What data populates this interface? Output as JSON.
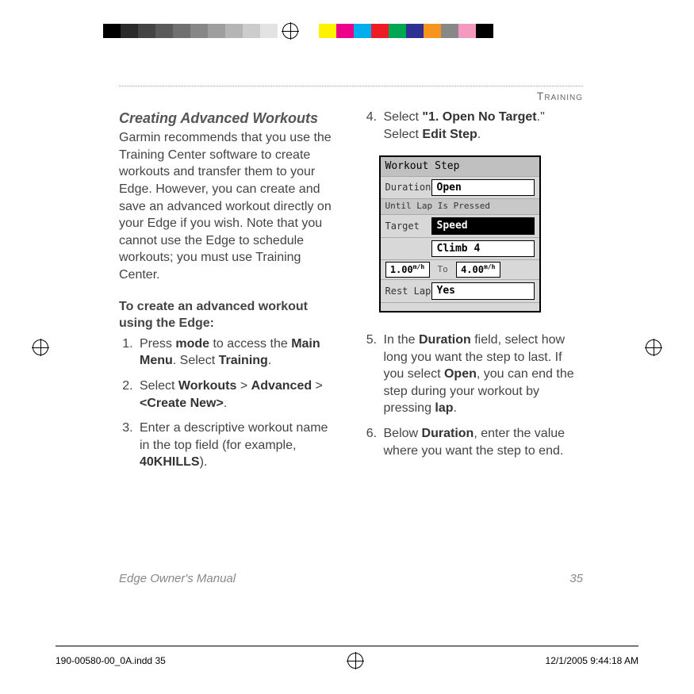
{
  "header": {
    "section": "Training"
  },
  "leftCol": {
    "title": "Creating Advanced Workouts",
    "intro": "Garmin recommends that you use the Training Center software to create workouts and transfer them to your Edge. However, you can create and save an advanced workout directly on your Edge if you wish. Note that you cannot use the Edge to schedule workouts; you must use Training Center.",
    "leadIn": "To create an advanced workout using the Edge:",
    "steps": {
      "s1_a": "Press ",
      "s1_b": "mode",
      "s1_c": " to access the ",
      "s1_d": "Main Menu",
      "s1_e": ". Select ",
      "s1_f": "Training",
      "s1_g": ".",
      "s2_a": "Select ",
      "s2_b": "Workouts",
      "s2_c": " > ",
      "s2_d": "Advanced",
      "s2_e": " > ",
      "s2_f": "<Create New>",
      "s2_g": ".",
      "s3_a": "Enter a descriptive workout name in the top field (for example, ",
      "s3_b": "40KHILLS",
      "s3_c": ")."
    }
  },
  "rightCol": {
    "s4_a": "Select ",
    "s4_b": "\"1. Open No Target",
    "s4_c": ".\" Select ",
    "s4_d": "Edit Step",
    "s4_e": ".",
    "screen": {
      "title": "Workout Step",
      "durationLabel": "Duration",
      "durationValue": "Open",
      "untilNote": "Until Lap Is Pressed",
      "targetLabel": "Target",
      "targetValue": "Speed",
      "zoneValue": "Climb 4",
      "fromValue": "1.00",
      "fromUnit": "m/h",
      "toLabel": "To",
      "toValue": "4.00",
      "toUnit": "m/h",
      "restLabel": "Rest Lap",
      "restValue": "Yes"
    },
    "s5_a": "In the ",
    "s5_b": "Duration",
    "s5_c": " field, select how long you want the step to last. If you select ",
    "s5_d": "Open",
    "s5_e": ", you can end the step during your workout by pressing ",
    "s5_f": "lap",
    "s5_g": ".",
    "s6_a": "Below ",
    "s6_b": "Duration",
    "s6_c": ", enter the value where you want the step to end."
  },
  "footer": {
    "left": "Edge Owner's Manual",
    "right": "35"
  },
  "imprint": {
    "file": "190-00580-00_0A.indd   35",
    "timestamp": "12/1/2005   9:44:18 AM"
  },
  "swatches": {
    "left": [
      "#000",
      "#2b2b2b",
      "#444",
      "#5a5a5a",
      "#707070",
      "#878787",
      "#9e9e9e",
      "#b5b5b5",
      "#ccc",
      "#e3e3e3"
    ],
    "right": [
      "#fff200",
      "#ec008c",
      "#00aeef",
      "#ed1c24",
      "#00a651",
      "#2e3192",
      "#f7941d",
      "#888",
      "#f49ac1",
      "#000"
    ]
  }
}
